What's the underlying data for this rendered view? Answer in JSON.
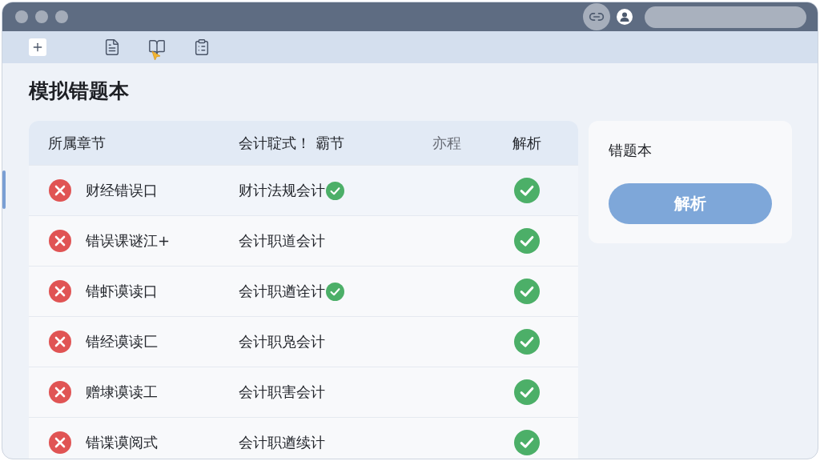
{
  "page": {
    "title": "模拟错题本"
  },
  "table": {
    "columns": [
      "所属章节",
      "会计聢式！ 霸节",
      "亦程",
      "解析"
    ],
    "rows": [
      {
        "correct": false,
        "chapter": "财经错误口",
        "subject": "财计法规会计",
        "verified": true,
        "analyzed": true
      },
      {
        "correct": false,
        "chapter": "错误课谜江+",
        "subject": "会计职道会计",
        "verified": false,
        "analyzed": true
      },
      {
        "correct": false,
        "chapter": "错虾谟读口",
        "subject": "会计职遒诠计",
        "verified": true,
        "analyzed": true
      },
      {
        "correct": false,
        "chapter": "错经谟读匚",
        "subject": "会计职凫会计",
        "verified": false,
        "analyzed": true
      },
      {
        "correct": false,
        "chapter": "赠埭谟读工",
        "subject": "会计职害会计",
        "verified": false,
        "analyzed": true
      },
      {
        "correct": false,
        "chapter": "错谍谟阅式",
        "subject": "会计职遒续计",
        "verified": false,
        "analyzed": true
      }
    ]
  },
  "side_panel": {
    "title": "错题本",
    "button": "解析"
  }
}
